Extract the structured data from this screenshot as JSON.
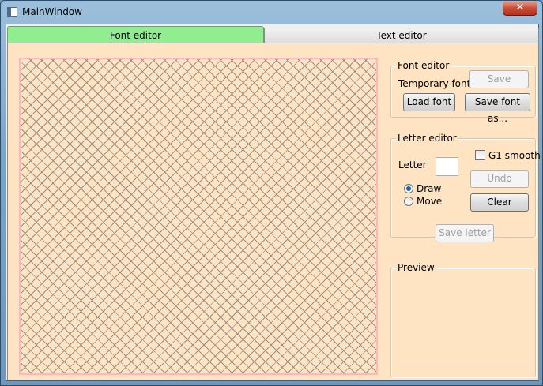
{
  "window": {
    "title": "MainWindow",
    "close_glyph": "✕"
  },
  "tabs": [
    {
      "label": "Font editor",
      "selected": true
    },
    {
      "label": "Text editor",
      "selected": false
    }
  ],
  "font_group": {
    "legend": "Font editor",
    "temporary_font_label": "Temporary font",
    "save_button": "Save",
    "load_button": "Load font",
    "save_as_button": "Save font as..."
  },
  "letter_group": {
    "legend": "Letter editor",
    "letter_label": "Letter",
    "letter_value": "",
    "g1_smooth_label": "G1 smooth",
    "g1_smooth_checked": false,
    "draw_label": "Draw",
    "move_label": "Move",
    "mode_selected": "Draw",
    "undo_button": "Undo",
    "clear_button": "Clear",
    "save_letter_button": "Save letter"
  },
  "preview_group": {
    "legend": "Preview"
  },
  "colors": {
    "active_tab": "#90ee90",
    "background": "#ffe4c4",
    "canvas_border": "#ffb6c1"
  }
}
